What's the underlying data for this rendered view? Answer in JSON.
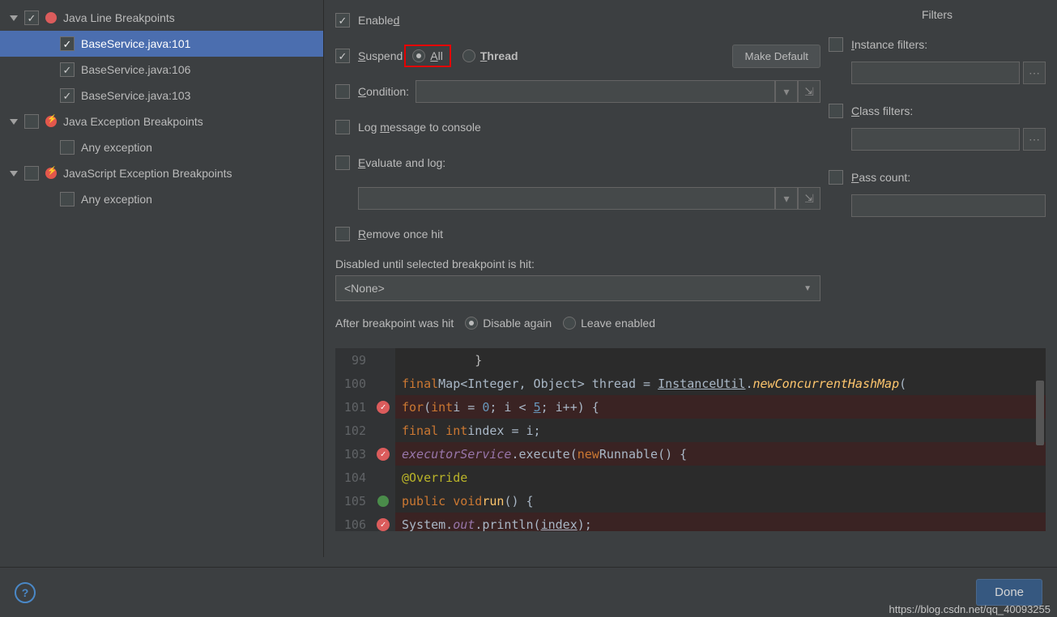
{
  "tree": {
    "groups": [
      {
        "label": "Java Line Breakpoints",
        "checked": true,
        "iconClass": "bp-red",
        "items": [
          {
            "label": "BaseService.java:101",
            "checked": true,
            "selected": true
          },
          {
            "label": "BaseService.java:106",
            "checked": true,
            "selected": false
          },
          {
            "label": "BaseService.java:103",
            "checked": true,
            "selected": false
          }
        ]
      },
      {
        "label": "Java Exception Breakpoints",
        "checked": false,
        "iconClass": "bp-exc",
        "items": [
          {
            "label": "Any exception",
            "checked": false,
            "selected": false
          }
        ]
      },
      {
        "label": "JavaScript Exception Breakpoints",
        "checked": false,
        "iconClass": "bp-exc",
        "items": [
          {
            "label": "Any exception",
            "checked": false,
            "selected": false
          }
        ]
      }
    ]
  },
  "opts": {
    "enabled_label": "Enabled",
    "enabled_u": "d",
    "suspend_label": "Suspend",
    "suspend_u": "S",
    "all_label": "All",
    "all_u": "A",
    "thread_label": "Thread",
    "thread_u": "T",
    "make_default": "Make Default",
    "condition_label": "Condition:",
    "condition_u": "C",
    "log_label": "Log message to console",
    "log_u": "m",
    "eval_label": "Evaluate and log:",
    "eval_u": "E",
    "remove_label": "Remove once hit",
    "remove_u": "R",
    "disabled_until": "Disabled until selected breakpoint is hit:",
    "none": "<None>",
    "after_hit": "After breakpoint was hit",
    "disable_again": "Disable again",
    "leave_enabled": "Leave enabled"
  },
  "filters": {
    "title": "Filters",
    "instance": "Instance filters:",
    "instance_u": "I",
    "class": "Class filters:",
    "class_u": "C",
    "pass": "Pass count:",
    "pass_u": "P"
  },
  "code": {
    "lines": [
      {
        "n": "99",
        "bp": "",
        "html": "          }"
      },
      {
        "n": "100",
        "bp": "",
        "html": "          <span class='c-kw'>final</span> <span class='c-def'>Map&lt;Integer, Object&gt; thread = </span><span class='c-cls'>InstanceUtil</span><span class='c-def'>.</span><span class='c-mth'>newConcurrentHashMap</span><span class='c-def'>(</span>"
      },
      {
        "n": "101",
        "bp": "bp",
        "html": "          <span class='c-kw'>for</span> <span class='c-def'>(</span><span class='c-kw'>int</span> <span class='c-def'>i = </span><span class='c-num'>0</span><span class='c-def'>; i &lt; </span><span class='c-num' style='text-decoration:underline'>5</span><span class='c-def'>; i++) {</span>"
      },
      {
        "n": "102",
        "bp": "",
        "html": "              <span class='c-kw'>final int</span> <span class='c-def'>index = i;</span>"
      },
      {
        "n": "103",
        "bp": "bp",
        "html": "              <span class='c-fld'>executorService</span><span class='c-def'>.execute(</span><span class='c-kw'>new</span> <span class='c-def'>Runnable() {</span>"
      },
      {
        "n": "104",
        "bp": "",
        "html": "                  <span class='c-ann'>@Override</span>"
      },
      {
        "n": "105",
        "bp": "ovr",
        "html": "                  <span class='c-kw'>public void</span> <span class='c-mth' style='font-style:normal;color:#ffc66d'>run</span><span class='c-def'>() {</span>"
      },
      {
        "n": "106",
        "bp": "bp",
        "html": "                      <span class='c-def'>System.</span><span class='c-fld'>out</span><span class='c-def'>.println(</span><span class='c-cls'>index</span><span class='c-def'>);</span>"
      }
    ]
  },
  "footer": {
    "done": "Done",
    "watermark": "https://blog.csdn.net/qq_40093255"
  }
}
